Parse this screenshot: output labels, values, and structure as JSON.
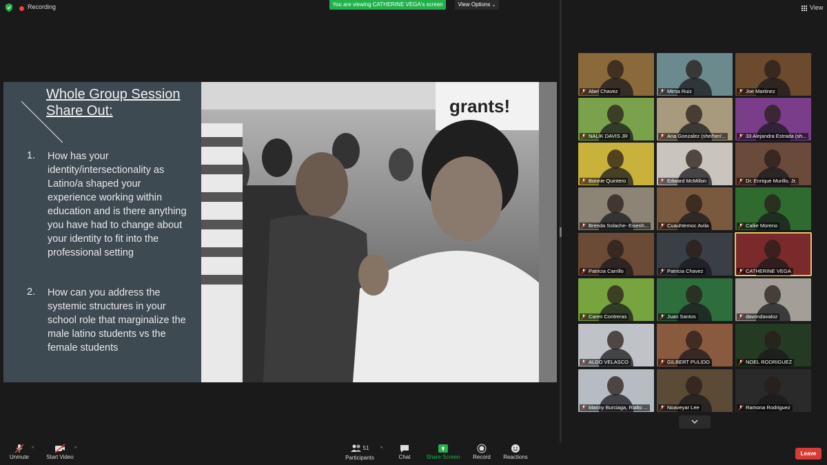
{
  "topbar": {
    "recording_label": "Recording",
    "viewing_banner": "You are viewing CATHERINE VEGA's screen",
    "view_options_label": "View Options",
    "view_label": "View"
  },
  "slide": {
    "title": "Whole Group Session Share Out:",
    "questions": [
      {
        "num": "1.",
        "text": "How has your identity/intersectionality as Latino/a shaped your experience working within education and is there anything you have had to change about your identity to fit into the professional setting"
      },
      {
        "num": "2.",
        "text": "How can you address the systemic structures in your school role that marginalize the male latino students vs the female students"
      }
    ],
    "photo_sign_text": "grants!"
  },
  "participants": [
    {
      "name": "Abel Chavez",
      "bg": "#8a6a3a"
    },
    {
      "name": "Mirna Ruiz",
      "bg": "#6a8a8e"
    },
    {
      "name": "Joe Martinez",
      "bg": "#6b4a2e"
    },
    {
      "name": "NALIK DAVIS JR",
      "bg": "#7aa24a"
    },
    {
      "name": "Ana Gonzalez (she/her/...",
      "bg": "#a89a7c"
    },
    {
      "name": "33 Alejandra Estrada (sh...",
      "bg": "#7a3d8a"
    },
    {
      "name": "Bonnie Quintero",
      "bg": "#c9b23c"
    },
    {
      "name": "Edward McMillon",
      "bg": "#c9c4bd"
    },
    {
      "name": "Dr. Enrique Murillo, Jr.",
      "bg": "#6a4a3a"
    },
    {
      "name": "Brenda Solache- Eisenh...",
      "bg": "#8c8475"
    },
    {
      "name": "Cuauhtemoc Avila",
      "bg": "#7a5a3e"
    },
    {
      "name": "Callie Moreno",
      "bg": "#2f6b2f"
    },
    {
      "name": "Patricia Carrillo",
      "bg": "#6b4a36"
    },
    {
      "name": "Patricia Chavez",
      "bg": "#3a3f46"
    },
    {
      "name": "CATHERINE VEGA",
      "bg": "#7a2a2a"
    },
    {
      "name": "Caren Contreras",
      "bg": "#77a43e"
    },
    {
      "name": "Juan Santos",
      "bg": "#2e6e3c"
    },
    {
      "name": "davondavaloz",
      "bg": "#a39e98"
    },
    {
      "name": "ALDO VELASCO",
      "bg": "#bfc3c8"
    },
    {
      "name": "GILBERT PULIDO",
      "bg": "#8a5a3e"
    },
    {
      "name": "NOEL RODRIGUEZ",
      "bg": "#253a22"
    },
    {
      "name": "Manny Burciaga, Rialto ...",
      "bg": "#b6bcc2"
    },
    {
      "name": "Noaveyar Lee",
      "bg": "#5a4a36"
    },
    {
      "name": "Ramona Rodriguez",
      "bg": "#2a2a2a"
    }
  ],
  "toolbar": {
    "unmute": "Unmute",
    "start_video": "Start Video",
    "participants": "Participants",
    "participants_count": "51",
    "chat": "Chat",
    "share_screen": "Share Screen",
    "record": "Record",
    "reactions": "Reactions",
    "leave": "Leave"
  },
  "colors": {
    "share_green": "#22b14c",
    "leave_red": "#d83a34",
    "active_speaker": "#e7c46a",
    "slide_panel": "#3e4a52"
  }
}
